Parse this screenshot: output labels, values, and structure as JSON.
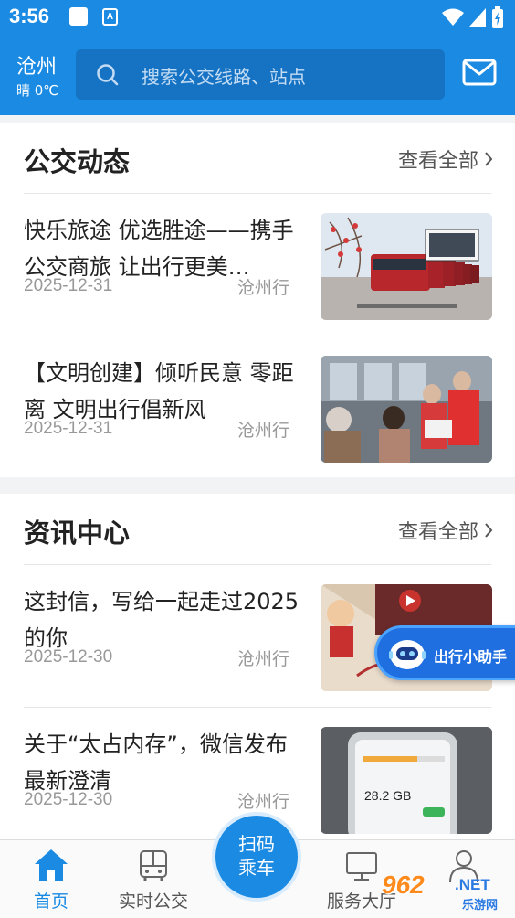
{
  "status_bar": {
    "time": "3:56",
    "notification_icon": "A"
  },
  "header": {
    "city": "沧州",
    "weather": "晴 0℃",
    "search_placeholder": "搜索公交线路、站点"
  },
  "bus_news": {
    "title": "公交动态",
    "more_label": "查看全部",
    "items": [
      {
        "title": "快乐旅途 优选胜途——携手公交商旅 让出行更美…",
        "date": "2025-12-31",
        "source": "沧州行"
      },
      {
        "title": "【文明创建】倾听民意 零距离 文明出行倡新风",
        "date": "2025-12-31",
        "source": "沧州行"
      }
    ]
  },
  "info_center": {
    "title": "资讯中心",
    "more_label": "查看全部",
    "items": [
      {
        "title": "这封信，写给一起走过2025的你",
        "date": "2025-12-30",
        "source": "沧州行"
      },
      {
        "title": "关于“太占内存”，微信发布最新澄清",
        "date": "2025-12-30",
        "source": "沧州行"
      }
    ]
  },
  "assistant": {
    "label": "出行小助手"
  },
  "thumb_text": {
    "phone_storage": "28.2 GB"
  },
  "tabbar": {
    "home": "首页",
    "realtime": "实时公交",
    "scan_line1": "扫码",
    "scan_line2": "乘车",
    "service": "服务大厅"
  },
  "watermark": {
    "big": "962",
    "net": ".NET",
    "small": "乐游网"
  },
  "colors": {
    "primary": "#1a8ae3",
    "search_bg": "#1673c4"
  }
}
